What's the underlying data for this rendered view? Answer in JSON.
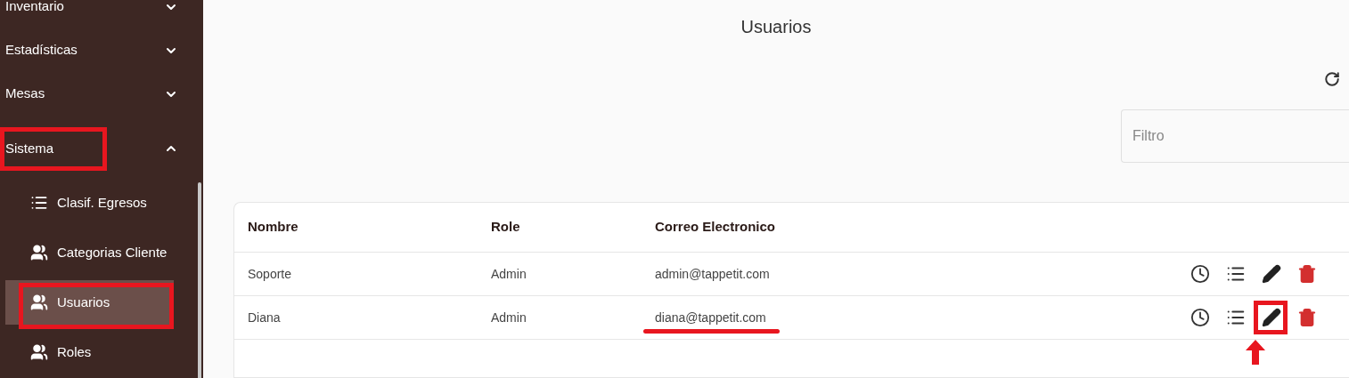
{
  "sidebar": {
    "items": [
      {
        "label": "Inventario",
        "expanded": false,
        "highlighted": false
      },
      {
        "label": "Estadísticas",
        "expanded": false,
        "highlighted": false
      },
      {
        "label": "Mesas",
        "expanded": false,
        "highlighted": false
      },
      {
        "label": "Sistema",
        "expanded": true,
        "highlighted": true,
        "children": [
          {
            "label": "Clasif. Egresos",
            "kind": "list",
            "selected": false,
            "highlighted": false
          },
          {
            "label": "Categorias Cliente",
            "kind": "people",
            "selected": false,
            "highlighted": false
          },
          {
            "label": "Usuarios",
            "kind": "people",
            "selected": true,
            "highlighted": true
          },
          {
            "label": "Roles",
            "kind": "people",
            "selected": false,
            "highlighted": false
          }
        ]
      }
    ]
  },
  "page": {
    "title": "Usuarios"
  },
  "filter": {
    "placeholder": "Filtro"
  },
  "table": {
    "columns": [
      "Nombre",
      "Role",
      "Correo Electronico"
    ],
    "rows": [
      {
        "cells": [
          "Soporte",
          "Admin",
          "admin@tappetit.com"
        ],
        "email_underlined": false,
        "edit_highlighted": false
      },
      {
        "cells": [
          "Diana",
          "Admin",
          "diana@tappetit.com"
        ],
        "email_underlined": true,
        "edit_highlighted": true
      }
    ]
  }
}
